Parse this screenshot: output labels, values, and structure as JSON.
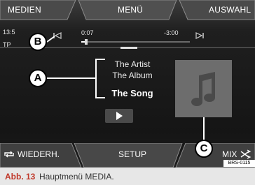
{
  "top_bar": {
    "left_label": "MEDIEN",
    "center_label": "MENÜ",
    "right_label": "AUSWAHL"
  },
  "status": {
    "clock": "13:5",
    "tp": "TP"
  },
  "player": {
    "elapsed": "0:07",
    "remaining": "-3:00",
    "progress": 0.03
  },
  "track": {
    "artist": "The Artist",
    "album": "The Album",
    "song": "The Song"
  },
  "bottom_bar": {
    "left_label": "WIEDERH.",
    "center_label": "SETUP",
    "right_label": "MIX"
  },
  "callouts": {
    "a": "A",
    "b": "B",
    "c": "C"
  },
  "image_code": "BRS-0115",
  "caption": {
    "figure": "Abb. 13",
    "text": "Hauptmenü MEDIA."
  },
  "icons": [
    "repeat-icon",
    "shuffle-icon",
    "previous-track-icon",
    "next-track-icon",
    "play-icon",
    "music-note-icon"
  ]
}
